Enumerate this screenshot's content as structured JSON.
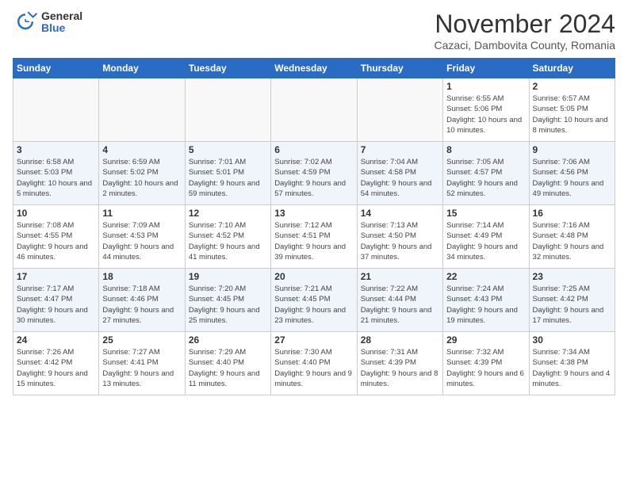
{
  "header": {
    "logo_general": "General",
    "logo_blue": "Blue",
    "month_title": "November 2024",
    "subtitle": "Cazaci, Dambovita County, Romania"
  },
  "days_of_week": [
    "Sunday",
    "Monday",
    "Tuesday",
    "Wednesday",
    "Thursday",
    "Friday",
    "Saturday"
  ],
  "weeks": [
    [
      {
        "day": "",
        "info": ""
      },
      {
        "day": "",
        "info": ""
      },
      {
        "day": "",
        "info": ""
      },
      {
        "day": "",
        "info": ""
      },
      {
        "day": "",
        "info": ""
      },
      {
        "day": "1",
        "info": "Sunrise: 6:55 AM\nSunset: 5:06 PM\nDaylight: 10 hours and 10 minutes."
      },
      {
        "day": "2",
        "info": "Sunrise: 6:57 AM\nSunset: 5:05 PM\nDaylight: 10 hours and 8 minutes."
      }
    ],
    [
      {
        "day": "3",
        "info": "Sunrise: 6:58 AM\nSunset: 5:03 PM\nDaylight: 10 hours and 5 minutes."
      },
      {
        "day": "4",
        "info": "Sunrise: 6:59 AM\nSunset: 5:02 PM\nDaylight: 10 hours and 2 minutes."
      },
      {
        "day": "5",
        "info": "Sunrise: 7:01 AM\nSunset: 5:01 PM\nDaylight: 9 hours and 59 minutes."
      },
      {
        "day": "6",
        "info": "Sunrise: 7:02 AM\nSunset: 4:59 PM\nDaylight: 9 hours and 57 minutes."
      },
      {
        "day": "7",
        "info": "Sunrise: 7:04 AM\nSunset: 4:58 PM\nDaylight: 9 hours and 54 minutes."
      },
      {
        "day": "8",
        "info": "Sunrise: 7:05 AM\nSunset: 4:57 PM\nDaylight: 9 hours and 52 minutes."
      },
      {
        "day": "9",
        "info": "Sunrise: 7:06 AM\nSunset: 4:56 PM\nDaylight: 9 hours and 49 minutes."
      }
    ],
    [
      {
        "day": "10",
        "info": "Sunrise: 7:08 AM\nSunset: 4:55 PM\nDaylight: 9 hours and 46 minutes."
      },
      {
        "day": "11",
        "info": "Sunrise: 7:09 AM\nSunset: 4:53 PM\nDaylight: 9 hours and 44 minutes."
      },
      {
        "day": "12",
        "info": "Sunrise: 7:10 AM\nSunset: 4:52 PM\nDaylight: 9 hours and 41 minutes."
      },
      {
        "day": "13",
        "info": "Sunrise: 7:12 AM\nSunset: 4:51 PM\nDaylight: 9 hours and 39 minutes."
      },
      {
        "day": "14",
        "info": "Sunrise: 7:13 AM\nSunset: 4:50 PM\nDaylight: 9 hours and 37 minutes."
      },
      {
        "day": "15",
        "info": "Sunrise: 7:14 AM\nSunset: 4:49 PM\nDaylight: 9 hours and 34 minutes."
      },
      {
        "day": "16",
        "info": "Sunrise: 7:16 AM\nSunset: 4:48 PM\nDaylight: 9 hours and 32 minutes."
      }
    ],
    [
      {
        "day": "17",
        "info": "Sunrise: 7:17 AM\nSunset: 4:47 PM\nDaylight: 9 hours and 30 minutes."
      },
      {
        "day": "18",
        "info": "Sunrise: 7:18 AM\nSunset: 4:46 PM\nDaylight: 9 hours and 27 minutes."
      },
      {
        "day": "19",
        "info": "Sunrise: 7:20 AM\nSunset: 4:45 PM\nDaylight: 9 hours and 25 minutes."
      },
      {
        "day": "20",
        "info": "Sunrise: 7:21 AM\nSunset: 4:45 PM\nDaylight: 9 hours and 23 minutes."
      },
      {
        "day": "21",
        "info": "Sunrise: 7:22 AM\nSunset: 4:44 PM\nDaylight: 9 hours and 21 minutes."
      },
      {
        "day": "22",
        "info": "Sunrise: 7:24 AM\nSunset: 4:43 PM\nDaylight: 9 hours and 19 minutes."
      },
      {
        "day": "23",
        "info": "Sunrise: 7:25 AM\nSunset: 4:42 PM\nDaylight: 9 hours and 17 minutes."
      }
    ],
    [
      {
        "day": "24",
        "info": "Sunrise: 7:26 AM\nSunset: 4:42 PM\nDaylight: 9 hours and 15 minutes."
      },
      {
        "day": "25",
        "info": "Sunrise: 7:27 AM\nSunset: 4:41 PM\nDaylight: 9 hours and 13 minutes."
      },
      {
        "day": "26",
        "info": "Sunrise: 7:29 AM\nSunset: 4:40 PM\nDaylight: 9 hours and 11 minutes."
      },
      {
        "day": "27",
        "info": "Sunrise: 7:30 AM\nSunset: 4:40 PM\nDaylight: 9 hours and 9 minutes."
      },
      {
        "day": "28",
        "info": "Sunrise: 7:31 AM\nSunset: 4:39 PM\nDaylight: 9 hours and 8 minutes."
      },
      {
        "day": "29",
        "info": "Sunrise: 7:32 AM\nSunset: 4:39 PM\nDaylight: 9 hours and 6 minutes."
      },
      {
        "day": "30",
        "info": "Sunrise: 7:34 AM\nSunset: 4:38 PM\nDaylight: 9 hours and 4 minutes."
      }
    ]
  ]
}
